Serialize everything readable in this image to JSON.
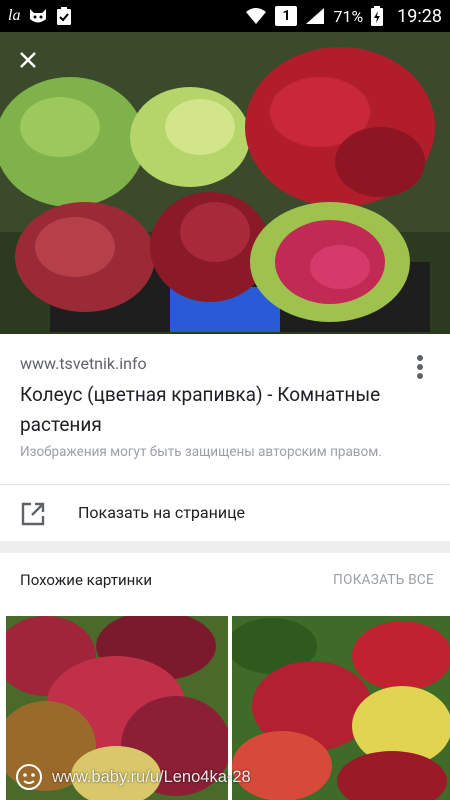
{
  "status_bar": {
    "app_icon_text": "la",
    "badge": "1",
    "battery": "71%",
    "time": "19:28"
  },
  "icons": {
    "close": "close-icon",
    "more": "more-vert-icon",
    "open_external": "open-in-new-icon",
    "wifi": "wifi-icon",
    "signal": "signal-icon",
    "battery": "battery-icon"
  },
  "image_result": {
    "source": "www.tsvetnik.info",
    "title": "Колеус (цветная крапивка) - Комнатные растения",
    "copyright_note": "Изображения могут быть защищены авторским правом.",
    "show_on_page_label": "Показать на странице"
  },
  "similar": {
    "title": "Похожие картинки",
    "show_all_label": "ПОКАЗАТЬ ВСЕ"
  },
  "watermark": {
    "text": "www.baby.ru/u/Leno4ka-28"
  }
}
